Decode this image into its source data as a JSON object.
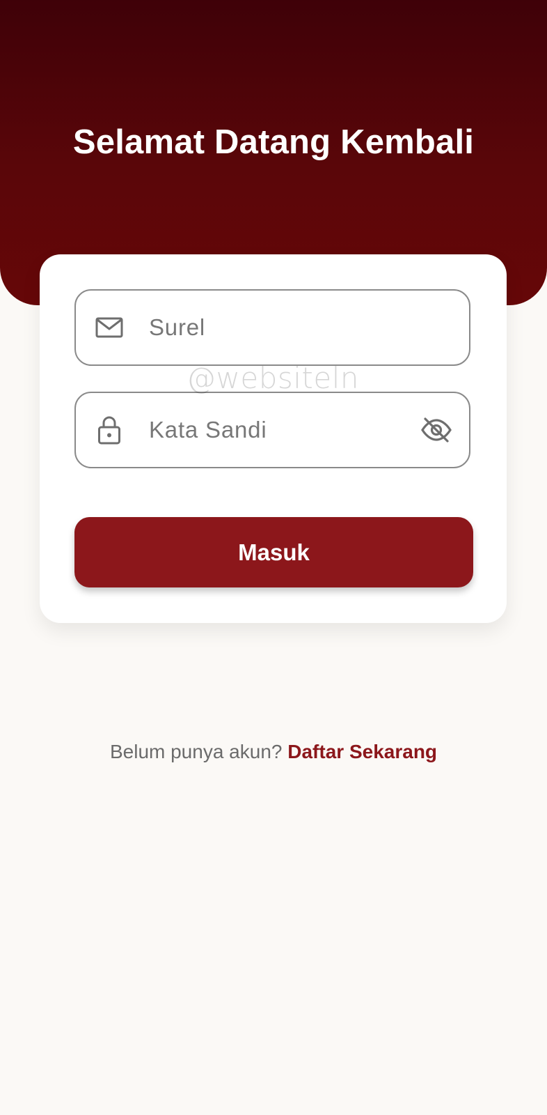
{
  "header": {
    "title": "Selamat Datang Kembali"
  },
  "form": {
    "email": {
      "placeholder": "Surel",
      "icon": "mail-icon"
    },
    "password": {
      "placeholder": "Kata Sandi",
      "icon": "lock-icon",
      "toggle_icon": "eye-off-icon"
    },
    "submit_label": "Masuk"
  },
  "watermark": "@websiteln",
  "footer": {
    "prompt": "Belum punya akun?",
    "link_label": "Daftar Sekarang"
  },
  "colors": {
    "header_dark": "#3f0108",
    "header_light": "#660708",
    "primary": "#8c171b",
    "background": "#fbf9f6"
  }
}
